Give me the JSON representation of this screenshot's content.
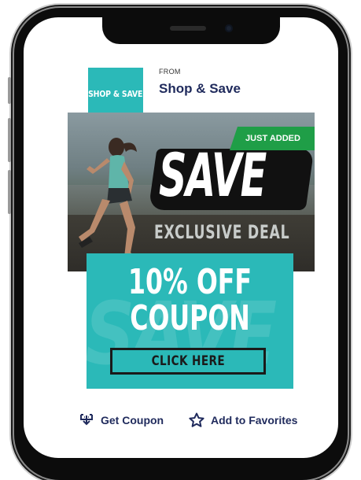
{
  "offer": {
    "from_label": "FROM",
    "store_name": "Shop & Save",
    "logo_text": "SHOP & SAVE",
    "badge": "JUST ADDED",
    "hero_headline": "SAVE",
    "hero_subtitle": "EXCLUSIVE DEAL",
    "coupon_line1": "10% OFF",
    "coupon_line2": "COUPON",
    "coupon_watermark": "SAVE",
    "cta_label": "CLICK HERE"
  },
  "actions": {
    "get_coupon_label": "Get Coupon",
    "get_coupon_icon": "download-tray-icon",
    "favorites_label": "Add to Favorites",
    "favorites_icon": "star-outline-icon"
  },
  "colors": {
    "brand_teal": "#2bb9b8",
    "badge_green": "#1f9e47",
    "text_navy": "#1f2a5c"
  }
}
